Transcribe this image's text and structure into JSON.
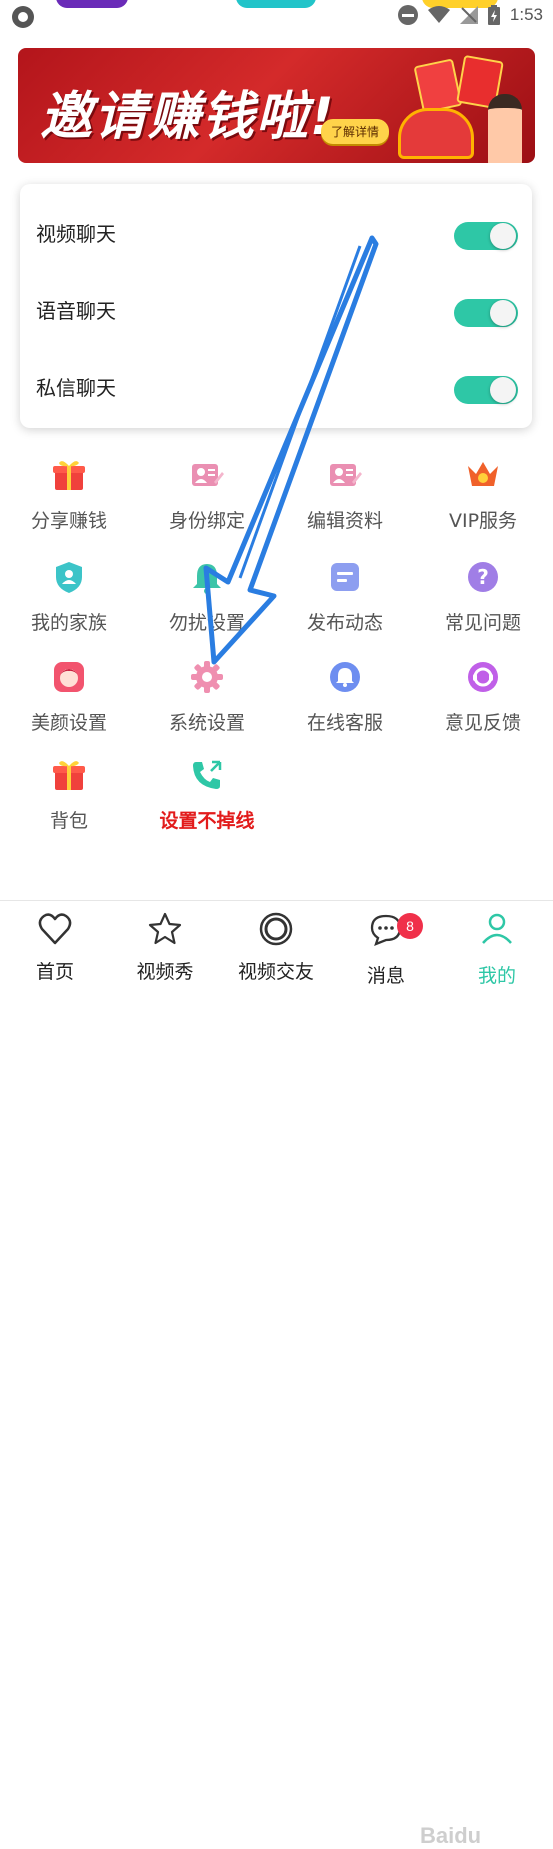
{
  "status_bar": {
    "time": "1:53"
  },
  "banner": {
    "title": "邀请赚钱啦!",
    "button": "了解详情"
  },
  "toggles": [
    {
      "label": "视频聊天",
      "on": true
    },
    {
      "label": "语音聊天",
      "on": true
    },
    {
      "label": "私信聊天",
      "on": true
    }
  ],
  "grid": [
    {
      "label": "分享赚钱",
      "icon": "gift-icon"
    },
    {
      "label": "身份绑定",
      "icon": "id-card-icon"
    },
    {
      "label": "编辑资料",
      "icon": "edit-profile-icon"
    },
    {
      "label": "VIP服务",
      "icon": "crown-icon"
    },
    {
      "label": "我的家族",
      "icon": "shield-user-icon"
    },
    {
      "label": "勿扰设置",
      "icon": "bell-icon"
    },
    {
      "label": "发布动态",
      "icon": "post-icon"
    },
    {
      "label": "常见问题",
      "icon": "question-icon"
    },
    {
      "label": "美颜设置",
      "icon": "beauty-face-icon"
    },
    {
      "label": "系统设置",
      "icon": "gear-icon"
    },
    {
      "label": "在线客服",
      "icon": "service-bell-icon"
    },
    {
      "label": "意见反馈",
      "icon": "feedback-icon"
    },
    {
      "label": "背包",
      "icon": "backpack-gift-icon"
    },
    {
      "label": "设置不掉线",
      "icon": "phone-call-icon"
    }
  ],
  "tabs": [
    {
      "label": "首页",
      "icon": "heart-icon"
    },
    {
      "label": "视频秀",
      "icon": "star-icon"
    },
    {
      "label": "视频交友",
      "icon": "ring-icon"
    },
    {
      "label": "消息",
      "icon": "chat-bubble-icon",
      "badge": "8"
    },
    {
      "label": "我的",
      "icon": "person-icon",
      "active": true
    }
  ],
  "watermark": "Baidu",
  "colors": {
    "accent": "#2ec7a6",
    "banner": "#c41e22",
    "annotation_arrow": "#2a7de1",
    "highlight_text": "#e21b1b"
  }
}
